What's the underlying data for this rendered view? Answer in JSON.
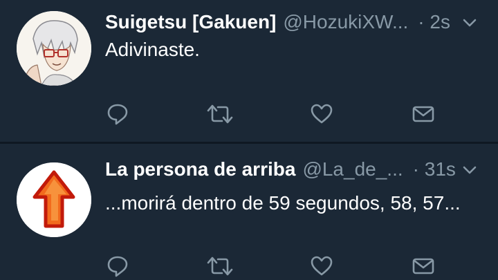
{
  "tweets": [
    {
      "author_name": "Suigetsu [Gakuen]",
      "handle": "@HozukiXW...",
      "time": "· 2s",
      "text": "Adivinaste.",
      "avatar_icon": "anime-character-avatar"
    },
    {
      "author_name": "La persona de arriba",
      "handle": "@La_de_...",
      "time": "· 31s",
      "text": "...morirá dentro de 59 segundos, 58, 57...",
      "avatar_icon": "orange-up-arrow-avatar"
    }
  ],
  "colors": {
    "background": "#1b2836",
    "secondary_text": "#8899a6",
    "divider": "#0f1822",
    "arrow_fill": "#f26b1d",
    "arrow_outline": "#c21a0a"
  },
  "icons": [
    "reply-icon",
    "retweet-icon",
    "like-icon",
    "direct-message-icon",
    "chevron-down-icon"
  ]
}
